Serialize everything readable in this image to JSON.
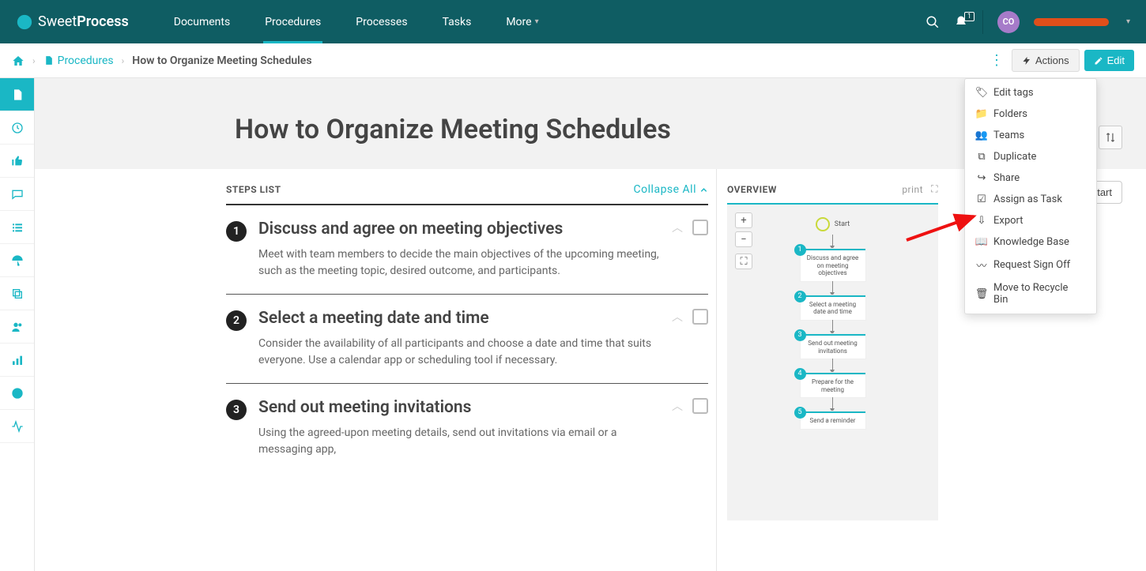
{
  "logo": {
    "sweet": "Sweet",
    "process": "Process"
  },
  "nav": {
    "items": [
      "Documents",
      "Procedures",
      "Processes",
      "Tasks",
      "More"
    ],
    "active_index": 1,
    "notif_badge": "1",
    "avatar": "CO"
  },
  "breadcrumb": {
    "procedures": "Procedures",
    "current": "How to Organize Meeting Schedules"
  },
  "buttons": {
    "actions": "Actions",
    "edit": "Edit",
    "start": "Start"
  },
  "hero": {
    "title": "How to Organize Meeting Schedules"
  },
  "steps_header": "STEPS LIST",
  "collapse_all": "Collapse All",
  "steps": [
    {
      "num": "1",
      "title": "Discuss and agree on meeting objectives",
      "desc": "Meet with team members to decide the main objectives of the upcoming meeting, such as the meeting topic, desired outcome, and participants."
    },
    {
      "num": "2",
      "title": "Select a meeting date and time",
      "desc": "Consider the availability of all participants and choose a date and time that suits everyone. Use a calendar app or scheduling tool if necessary."
    },
    {
      "num": "3",
      "title": "Send out meeting invitations",
      "desc": "Using the agreed-upon meeting details, send out invitations via email or a messaging app,"
    }
  ],
  "overview": {
    "title": "OVERVIEW",
    "print": "print",
    "start": "Start"
  },
  "flow_nodes": [
    "Discuss and agree on meeting objectives",
    "Select a meeting date and time",
    "Send out meeting invitations",
    "Prepare for the meeting",
    "Send a reminder"
  ],
  "dropdown": [
    {
      "icon": "🏷",
      "label": "Edit tags"
    },
    {
      "icon": "📁",
      "label": "Folders"
    },
    {
      "icon": "👥",
      "label": "Teams"
    },
    {
      "icon": "⧉",
      "label": "Duplicate"
    },
    {
      "icon": "↪",
      "label": "Share"
    },
    {
      "icon": "☑",
      "label": "Assign as Task"
    },
    {
      "icon": "⇩",
      "label": "Export"
    },
    {
      "icon": "📖",
      "label": "Knowledge Base"
    },
    {
      "icon": "〰",
      "label": "Request Sign Off"
    },
    {
      "icon": "🗑",
      "label": "Move to Recycle Bin"
    }
  ]
}
